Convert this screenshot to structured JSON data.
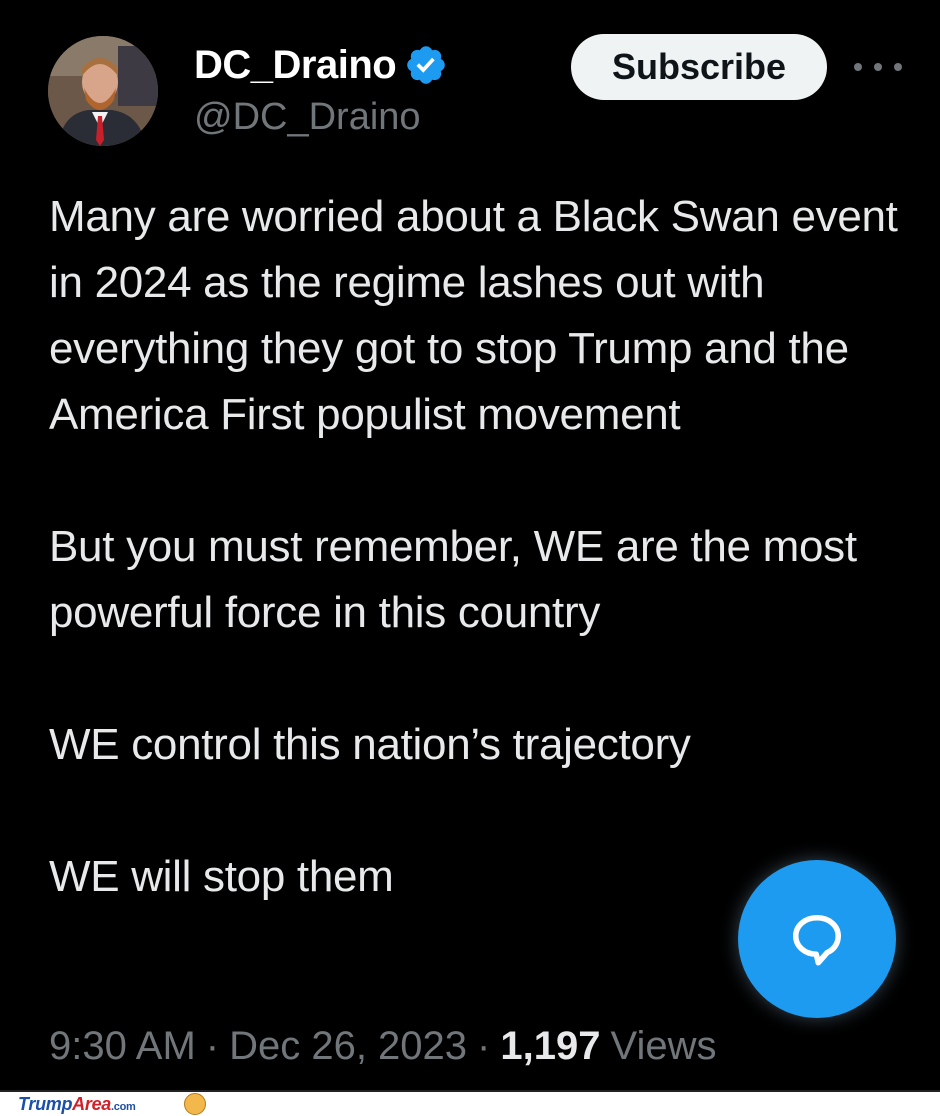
{
  "user": {
    "display_name": "DC_Draino",
    "handle": "@DC_Draino",
    "verified_icon": "verified-badge-icon",
    "accent_color": "#1d9bf0"
  },
  "header": {
    "subscribe_label": "Subscribe",
    "more_icon": "more-dots-icon"
  },
  "tweet": {
    "paragraphs": [
      "Many are worried about a Black Swan event in 2024 as the regime lashes out with everything they got to stop Trump and the America First populist movement",
      "But you must remember, WE are the most powerful force in this country",
      "WE control this nation’s trajectory",
      "WE will stop them"
    ],
    "time": "9:30 AM",
    "date": "Dec 26, 2023",
    "separator": "·",
    "views_count": "1,197",
    "views_label": "Views"
  },
  "fab": {
    "icon": "reply-bubble-icon"
  },
  "watermark": {
    "brand_part1": "Trump",
    "brand_part2": "Area",
    "brand_suffix": ".com",
    "icon": "trump-face-icon"
  }
}
